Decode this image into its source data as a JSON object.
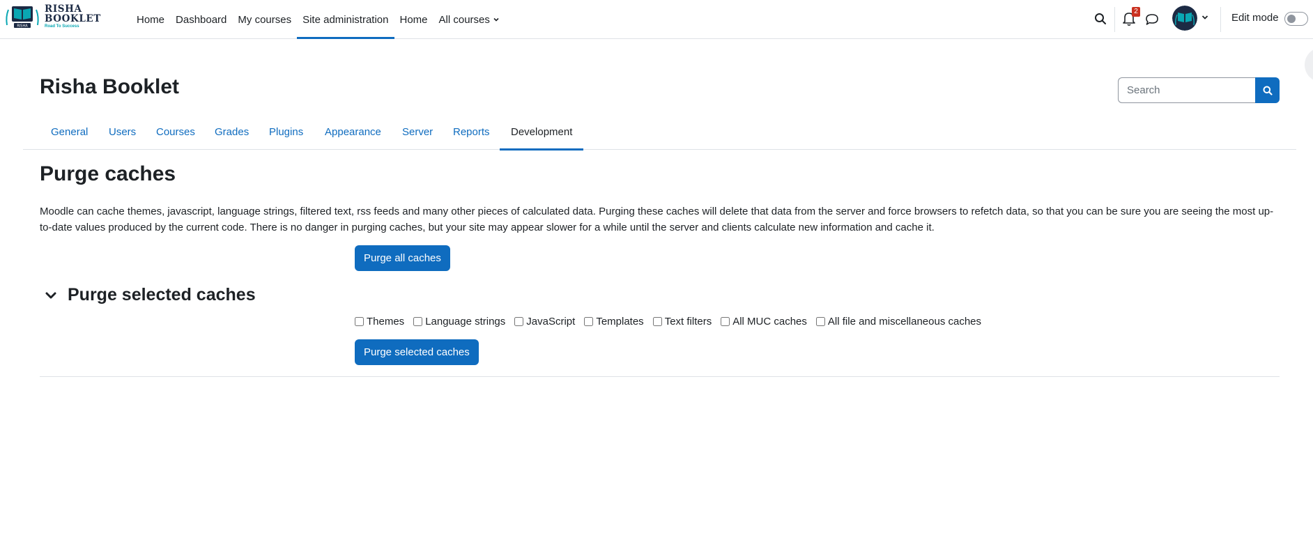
{
  "brand": {
    "line1": "RISHA",
    "line2": "BOOKLET",
    "tagline": "Road To Success",
    "emblem_text": "RISHA"
  },
  "primary_nav": {
    "items": [
      {
        "label": "Home"
      },
      {
        "label": "Dashboard"
      },
      {
        "label": "My courses"
      },
      {
        "label": "Site administration",
        "active": true
      },
      {
        "label": "Home"
      },
      {
        "label": "All courses"
      }
    ]
  },
  "user_menu": {
    "notification_count": "2",
    "edit_mode_label": "Edit mode",
    "edit_mode_on": false
  },
  "header": {
    "site_title": "Risha Booklet",
    "search_placeholder": "Search"
  },
  "secondary_nav": {
    "tabs": [
      {
        "label": "General"
      },
      {
        "label": "Users"
      },
      {
        "label": "Courses"
      },
      {
        "label": "Grades"
      },
      {
        "label": "Plugins"
      },
      {
        "label": "Appearance"
      },
      {
        "label": "Server"
      },
      {
        "label": "Reports"
      },
      {
        "label": "Development",
        "active": true
      }
    ]
  },
  "main": {
    "heading": "Purge caches",
    "intro": "Moodle can cache themes, javascript, language strings, filtered text, rss feeds and many other pieces of calculated data. Purging these caches will delete that data from the server and force browsers to refetch data, so that you can be sure you are seeing the most up-to-date values produced by the current code. There is no danger in purging caches, but your site may appear slower for a while until the server and clients calculate new information and cache it.",
    "purge_all_label": "Purge all caches",
    "section_title": "Purge selected caches",
    "checkboxes": [
      {
        "label": "Themes",
        "checked": false
      },
      {
        "label": "Language strings",
        "checked": false
      },
      {
        "label": "JavaScript",
        "checked": false
      },
      {
        "label": "Templates",
        "checked": false
      },
      {
        "label": "Text filters",
        "checked": false
      },
      {
        "label": "All MUC caches",
        "checked": false
      },
      {
        "label": "All file and miscellaneous caches",
        "checked": false
      }
    ],
    "purge_selected_label": "Purge selected caches"
  },
  "colors": {
    "primary": "#0f6cbf",
    "text": "#1d2125",
    "border": "#dee2e6",
    "badge": "#ca3120",
    "brand_dark": "#1c2a44",
    "brand_teal": "#0aa7b3"
  }
}
